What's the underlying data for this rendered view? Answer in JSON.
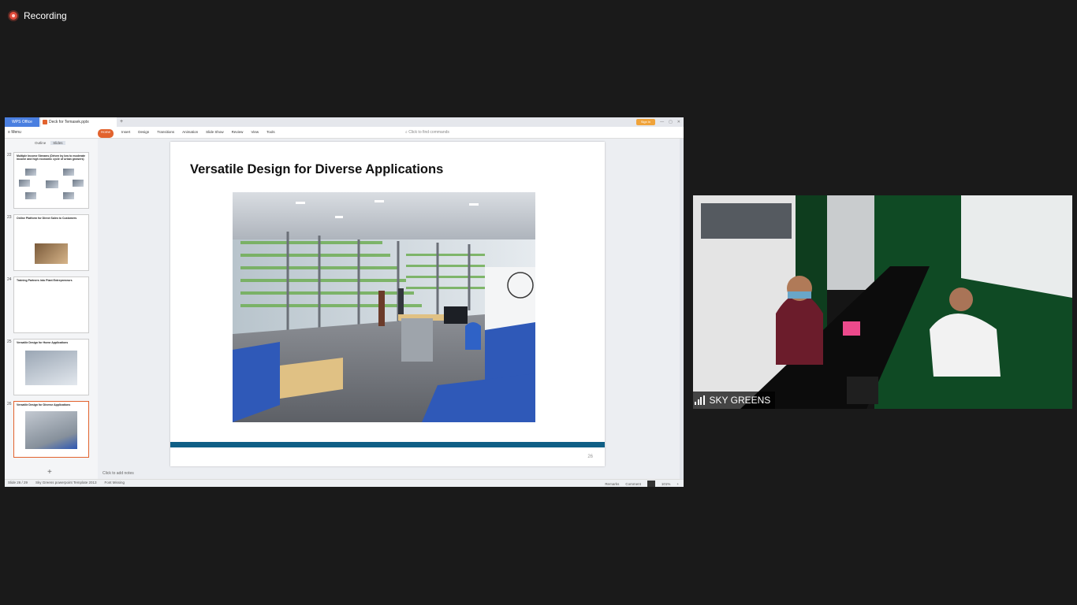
{
  "recording": {
    "label": "Recording",
    "icon": "record-icon"
  },
  "app": {
    "tabs": {
      "wps": "WPS Office",
      "doc": "Deck for Temasek.pptx"
    },
    "menu_label": "Menu",
    "ribbon_tabs": [
      "Home",
      "Insert",
      "Design",
      "Transitions",
      "Animation",
      "Slide Show",
      "Review",
      "View",
      "Tools"
    ],
    "find_placeholder": "Click to find commands",
    "sign_in": "Sign in"
  },
  "left_panel": {
    "tabs": [
      "Outline",
      "Slides"
    ],
    "thumbnails": [
      {
        "number": "22",
        "title": "Multiple Income Streams (Driven by low to moderate income and high economic cycle of urban growers)"
      },
      {
        "number": "23",
        "title": "Online Platform for Direct Sales to Customers"
      },
      {
        "number": "24",
        "title": "Training Partners into Plant Entrepreneurs"
      },
      {
        "number": "25",
        "title": "Versatile Design for Home Applications"
      },
      {
        "number": "26",
        "title": "Versatile Design for Diverse Applications"
      }
    ]
  },
  "slide": {
    "title": "Versatile Design for Diverse Applications",
    "number": "26"
  },
  "notes_placeholder": "Click to add notes",
  "status": {
    "slide_counter": "Slide 26 / 29",
    "template": "Sky Greens powerpoint Template 2013",
    "font_missing": "Font Missing",
    "remarks": "Remarks",
    "comment": "Comment",
    "zoom": "101%"
  },
  "video": {
    "participant": "SKY GREENS",
    "signal_icon": "signal-bars-icon"
  }
}
